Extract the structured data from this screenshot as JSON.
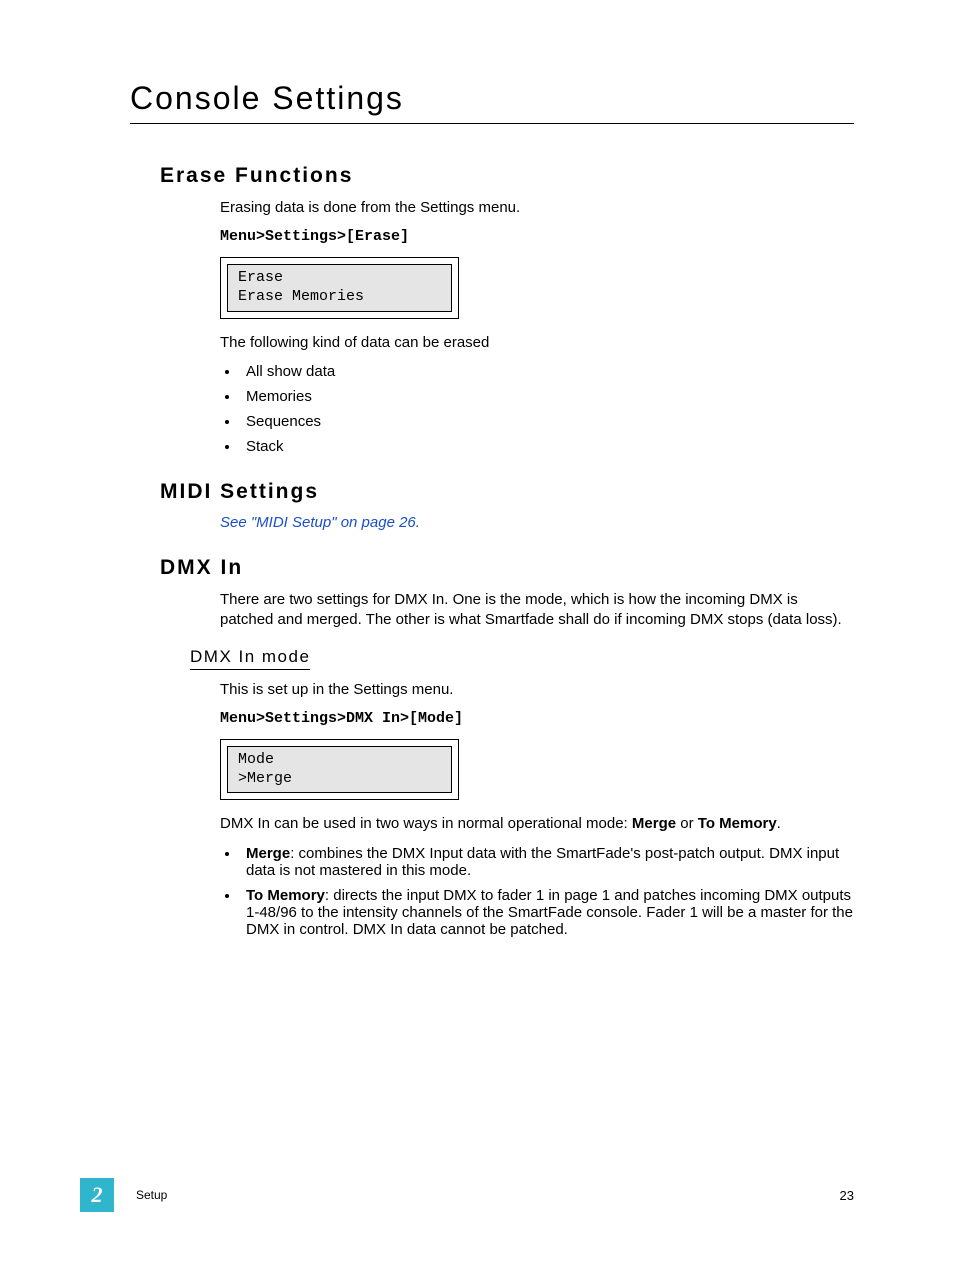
{
  "title": "Console Settings",
  "erase": {
    "heading": "Erase Functions",
    "intro": "Erasing data is done from the Settings menu.",
    "path": "Menu>Settings>[Erase]",
    "lcd_line1": "Erase",
    "lcd_line2": "Erase Memories",
    "list_intro": "The following kind of data can be erased",
    "items": [
      "All show data",
      "Memories",
      "Sequences",
      "Stack"
    ]
  },
  "midi": {
    "heading": "MIDI Settings",
    "link": "See \"MIDI Setup\" on page 26."
  },
  "dmx": {
    "heading": "DMX In",
    "intro": "There are two settings for DMX In. One is the mode, which is how the incoming DMX is patched and merged. The other is what Smartfade shall do if incoming DMX stops (data loss).",
    "sub_heading": "DMX In mode",
    "sub_intro": "This is set up in the Settings menu.",
    "path": "Menu>Settings>DMX In>[Mode]",
    "lcd_line1": "Mode",
    "lcd_line2": ">Merge",
    "modes_intro_pre": "DMX In can be used in two ways in normal operational mode: ",
    "modes_intro_b1": "Merge",
    "modes_intro_mid": " or ",
    "modes_intro_b2": "To Memory",
    "modes_intro_post": ".",
    "merge_label": "Merge",
    "merge_text": ": combines the DMX Input data with the SmartFade's post-patch output. DMX input data is not mastered in this mode.",
    "tomem_label": "To Memory",
    "tomem_text": ": directs the input DMX to fader 1 in page 1 and patches incoming DMX outputs 1-48/96 to the intensity channels of the SmartFade console. Fader 1 will be a master for the DMX in control. DMX In data cannot be patched."
  },
  "footer": {
    "chapter": "2",
    "section": "Setup",
    "page": "23"
  }
}
